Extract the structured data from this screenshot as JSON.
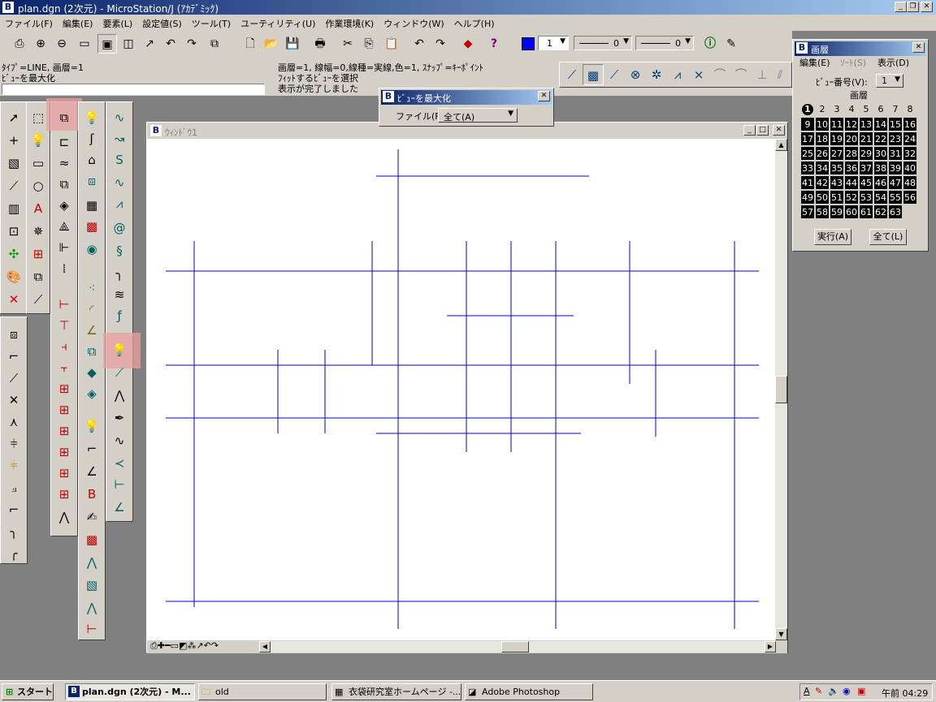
{
  "window": {
    "title": "plan.dgn (2次元) - MicroStation/J (ｱｶﾃﾞﾐｯｸ)",
    "logo": "B"
  },
  "menu": [
    "ファイル(F)",
    "編集(E)",
    "要素(L)",
    "設定値(S)",
    "ツール(T)",
    "ユーティリティ(U)",
    "作業環境(K)",
    "ウィンドウ(W)",
    "ヘルプ(H)"
  ],
  "toolbar": {
    "level_value": "1",
    "weight_value": "0",
    "style_value": "0"
  },
  "status": {
    "left1": "ﾀｲﾌﾟ=LINE, 画層=1",
    "left2": "ﾋﾞｭｰを最大化",
    "mid1": "画層=1, 線幅=0,線種=実線,色=1, ｽﾅｯﾌﾟ=ｷｰﾎﾟｲﾝﾄ",
    "mid2": "ﾌｨｯﾄするﾋﾞｭｰを選択",
    "mid3": "表示が完了しました"
  },
  "maximize_dialog": {
    "title": "ﾋﾞｭｰを最大化",
    "file_label": "ファイル(F):",
    "select_value": "全て(A)"
  },
  "view_window": {
    "title": "ｳｨﾝﾄﾞｳ1"
  },
  "layer_panel": {
    "title": "画層",
    "menu": [
      "編集(E)",
      "ｿｰﾄ(S)",
      "表示(D)"
    ],
    "view_label": "ﾋﾞｭｰ番号(V):",
    "view_value": "1",
    "heading": "画層",
    "levels": [
      "1",
      "2",
      "3",
      "4",
      "5",
      "6",
      "7",
      "8",
      "9",
      "10",
      "11",
      "12",
      "13",
      "14",
      "15",
      "16",
      "17",
      "18",
      "19",
      "20",
      "21",
      "22",
      "23",
      "24",
      "25",
      "26",
      "27",
      "28",
      "29",
      "30",
      "31",
      "32",
      "33",
      "34",
      "35",
      "36",
      "37",
      "38",
      "39",
      "40",
      "41",
      "42",
      "43",
      "44",
      "45",
      "46",
      "47",
      "48",
      "49",
      "50",
      "51",
      "52",
      "53",
      "54",
      "55",
      "56",
      "57",
      "58",
      "59",
      "60",
      "61",
      "62",
      "63"
    ],
    "apply_button": "実行(A)",
    "all_button": "全て(L)"
  },
  "taskbar": {
    "start": "スタート",
    "tasks": [
      "plan.dgn (2次元) - M...",
      "old",
      "衣袋研究室ホームページ -...",
      "Adobe Photoshop"
    ],
    "clock": "午前 04:29",
    "tray_letter": "A"
  },
  "colors": {
    "line_color": "#0000cc",
    "title_active": "#0a246a",
    "face": "#d4d0c8",
    "highlight": "#e8a0a0"
  }
}
